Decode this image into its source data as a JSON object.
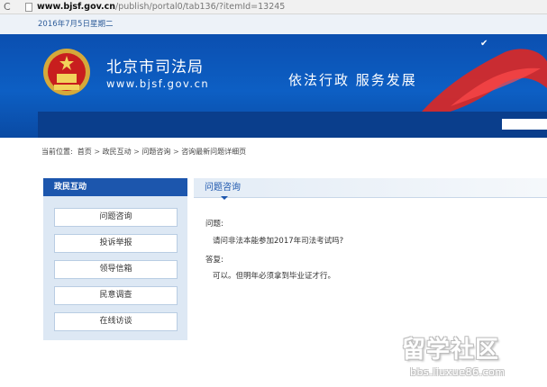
{
  "browser": {
    "url_host": "www.bjsf.gov.cn",
    "url_path": "/publish/portal0/tab136/?itemId=13245"
  },
  "header": {
    "date": "2016年7月5日星期二",
    "site_title": "北京市司法局",
    "site_url": "www.bjsf.gov.cn",
    "slogan": "依法行政  服务发展"
  },
  "breadcrumb": {
    "prefix": "当前位置:",
    "items": [
      "首页",
      "政民互动",
      "问题咨询",
      "咨询最新问题详细页"
    ]
  },
  "sidebar": {
    "title": "政民互动",
    "items": [
      {
        "label": "问题咨询"
      },
      {
        "label": "投诉举报"
      },
      {
        "label": "领导信箱"
      },
      {
        "label": "民意调查"
      },
      {
        "label": "在线访谈"
      }
    ]
  },
  "main": {
    "section_title": "问题咨询",
    "question_label": "问题:",
    "question_text": "请问非法本能参加2017年司法考试吗?",
    "answer_label": "答复:",
    "answer_text": "可以。但明年必须拿到毕业证才行。"
  },
  "watermark": {
    "big": "留学社区",
    "small": "bbs.liuxue86.com"
  },
  "colors": {
    "brand_blue": "#0d5fc4",
    "sidebar_head": "#1c56ad",
    "ribbon_red": "#d42a2a"
  }
}
